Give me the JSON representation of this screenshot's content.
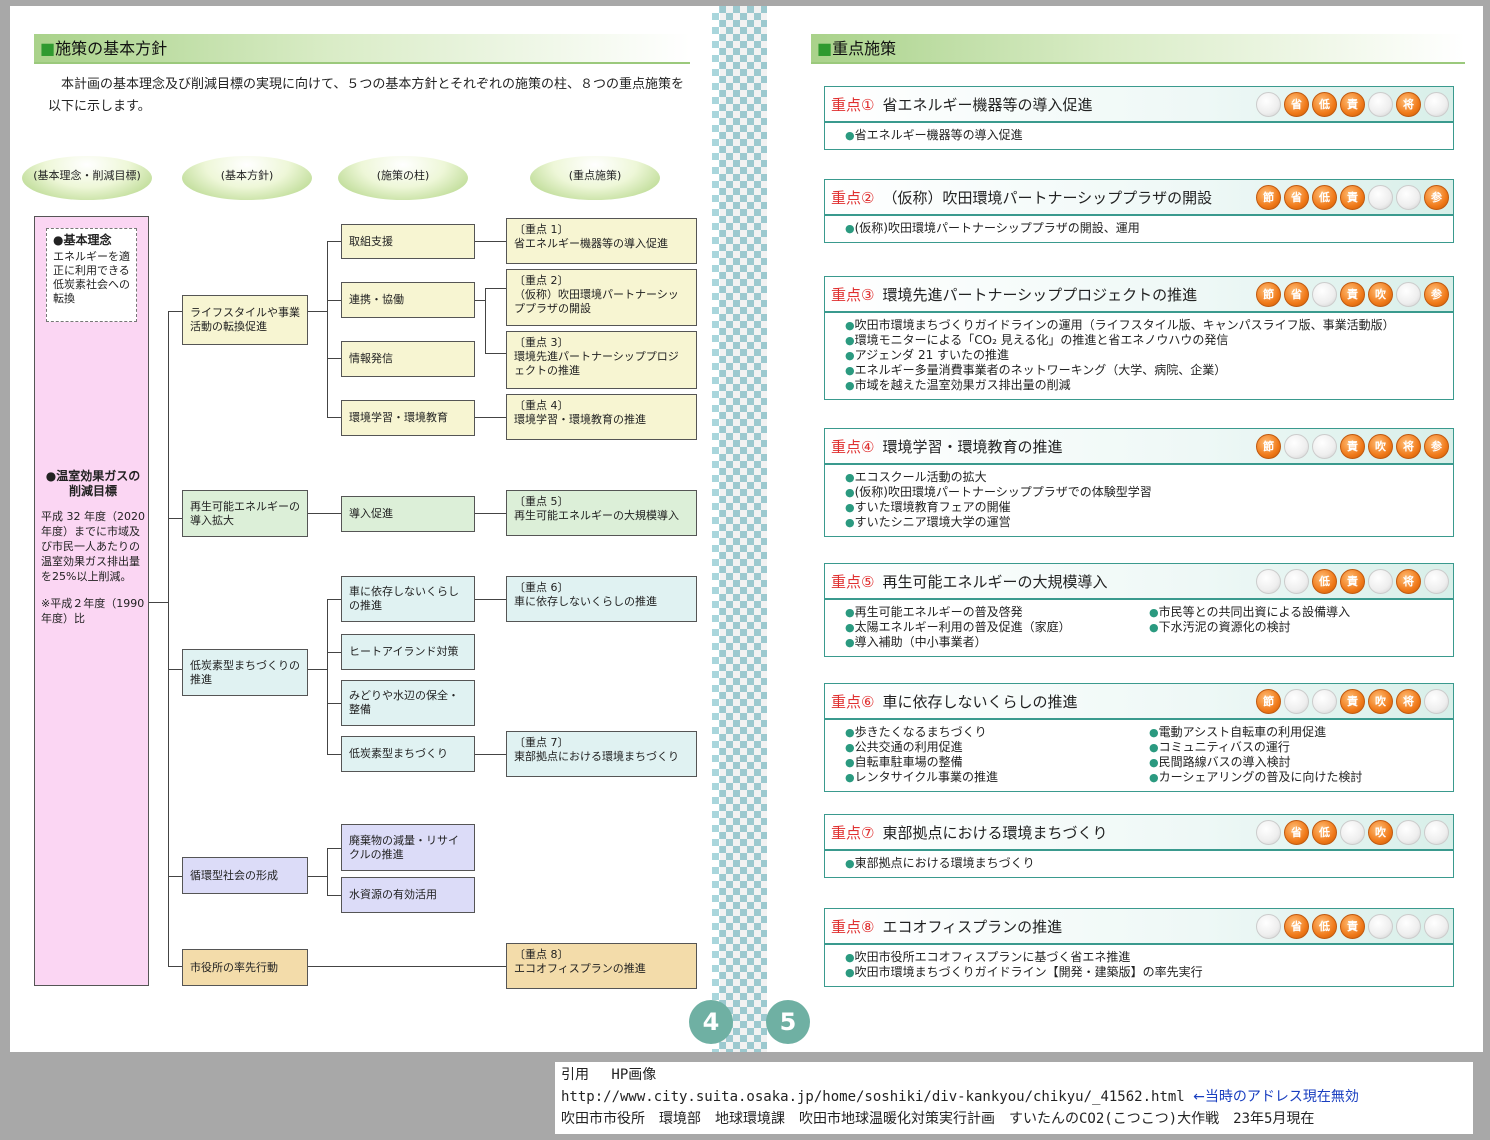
{
  "left": {
    "heading_mark": "■",
    "heading": "施策の基本方針",
    "intro": "本計画の基本理念及び削減目標の実現に向けて、５つの基本方針とそれぞれの施策の柱、８つの重点施策を以下に示します。",
    "pills": [
      "(基本理念・削減目標)",
      "(基本方針)",
      "(施策の柱)",
      "(重点施策)"
    ],
    "basic_title": "●基本理念",
    "basic_text": "エネルギーを適正に利用できる低炭素社会への転換",
    "target_title": "●温室効果ガスの削減目標",
    "target_text": "平成 32 年度（2020 年度）までに市域及び市民一人あたりの温室効果ガス排出量を25%以上削減。",
    "target_note": "※平成２年度（1990 年度）比",
    "policies": [
      "ライフスタイルや事業活動の転換促進",
      "再生可能エネルギーの導入拡大",
      "低炭素型まちづくりの推進",
      "循環型社会の形成",
      "市役所の率先行動"
    ],
    "pillars": [
      "取組支援",
      "連携・協働",
      "情報発信",
      "環境学習・環境教育",
      "導入促進",
      "車に依存しないくらしの推進",
      "ヒートアイランド対策",
      "みどりや水辺の保全・整備",
      "低炭素型まちづくり",
      "廃棄物の減量・リサイクルの推進",
      "水資源の有効活用"
    ],
    "priorities": [
      {
        "no": "〔重点 1〕",
        "text": "省エネルギー機器等の導入促進"
      },
      {
        "no": "〔重点 2〕",
        "text": "（仮称）吹田環境パートナーシッププラザの開設"
      },
      {
        "no": "〔重点 3〕",
        "text": "環境先進パートナーシッププロジェクトの推進"
      },
      {
        "no": "〔重点 4〕",
        "text": "環境学習・環境教育の推進"
      },
      {
        "no": "〔重点 5〕",
        "text": "再生可能エネルギーの大規模導入"
      },
      {
        "no": "〔重点 6〕",
        "text": "車に依存しないくらしの推進"
      },
      {
        "no": "〔重点 7〕",
        "text": "東部拠点における環境まちづくり"
      },
      {
        "no": "〔重点 8〕",
        "text": "エコオフィスプランの推進"
      }
    ],
    "page_no": "4"
  },
  "right": {
    "heading_mark": "■",
    "heading": "重点施策",
    "page_no": "5",
    "icon_labels": [
      "節",
      "省",
      "低",
      "責",
      "吹",
      "将",
      "参"
    ],
    "cards": [
      {
        "no": "重点①",
        "title": "省エネルギー機器等の導入促進",
        "icons": [
          false,
          true,
          true,
          true,
          false,
          true,
          false
        ],
        "items": [
          "省エネルギー機器等の導入促進"
        ],
        "items2": []
      },
      {
        "no": "重点②",
        "title": "（仮称）吹田環境パートナーシッププラザの開設",
        "icons": [
          true,
          true,
          true,
          true,
          false,
          false,
          true
        ],
        "items": [
          "(仮称)吹田環境パートナーシッププラザの開設、運用"
        ],
        "items2": []
      },
      {
        "no": "重点③",
        "title": "環境先進パートナーシッププロジェクトの推進",
        "icons": [
          true,
          true,
          false,
          true,
          true,
          false,
          true
        ],
        "items": [
          "吹田市環境まちづくりガイドラインの運用（ライフスタイル版、キャンパスライフ版、事業活動版）",
          "環境モニターによる「CO₂ 見える化」の推進と省エネノウハウの発信",
          "アジェンダ 21 すいたの推進",
          "エネルギー多量消費事業者のネットワーキング（大学、病院、企業）",
          "市域を越えた温室効果ガス排出量の削減"
        ],
        "items2": []
      },
      {
        "no": "重点④",
        "title": "環境学習・環境教育の推進",
        "icons": [
          true,
          false,
          false,
          true,
          true,
          true,
          true
        ],
        "items": [
          "エコスクール活動の拡大",
          "(仮称)吹田環境パートナーシッププラザでの体験型学習",
          "すいた環境教育フェアの開催",
          "すいたシニア環境大学の運営"
        ],
        "items2": []
      },
      {
        "no": "重点⑤",
        "title": "再生可能エネルギーの大規模導入",
        "icons": [
          false,
          false,
          true,
          true,
          false,
          true,
          false
        ],
        "items": [
          "再生可能エネルギーの普及啓発",
          "太陽エネルギー利用の普及促進（家庭）",
          "導入補助（中小事業者）"
        ],
        "items2": [
          "市民等との共同出資による設備導入",
          "下水汚泥の資源化の検討"
        ]
      },
      {
        "no": "重点⑥",
        "title": "車に依存しないくらしの推進",
        "icons": [
          true,
          false,
          false,
          true,
          true,
          true,
          false
        ],
        "items": [
          "歩きたくなるまちづくり",
          "公共交通の利用促進",
          "自転車駐車場の整備",
          "レンタサイクル事業の推進"
        ],
        "items2": [
          "電動アシスト自転車の利用促進",
          "コミュニティバスの運行",
          "民間路線バスの導入検討",
          "カーシェアリングの普及に向けた検討"
        ]
      },
      {
        "no": "重点⑦",
        "title": "東部拠点における環境まちづくり",
        "icons": [
          false,
          true,
          true,
          false,
          true,
          false,
          false
        ],
        "items": [
          "東部拠点における環境まちづくり"
        ],
        "items2": []
      },
      {
        "no": "重点⑧",
        "title": "エコオフィスプランの推進",
        "icons": [
          false,
          true,
          true,
          true,
          false,
          false,
          false
        ],
        "items": [
          "吹田市役所エコオフィスプランに基づく省エネ推進",
          "吹田市環境まちづくりガイドライン【開発・建築版】の率先実行"
        ],
        "items2": []
      }
    ]
  },
  "citation": {
    "line1": "引用　 HP画像",
    "url": "http://www.city.suita.osaka.jp/home/soshiki/div-kankyou/chikyu/_41562.html",
    "url_note": "←当時のアドレス現在無効",
    "line3": "吹田市市役所　環境部　地球環境課　吹田市地球温暖化対策実行計画　すいたんのCO2(こつこつ)大作戦　23年5月現在"
  }
}
